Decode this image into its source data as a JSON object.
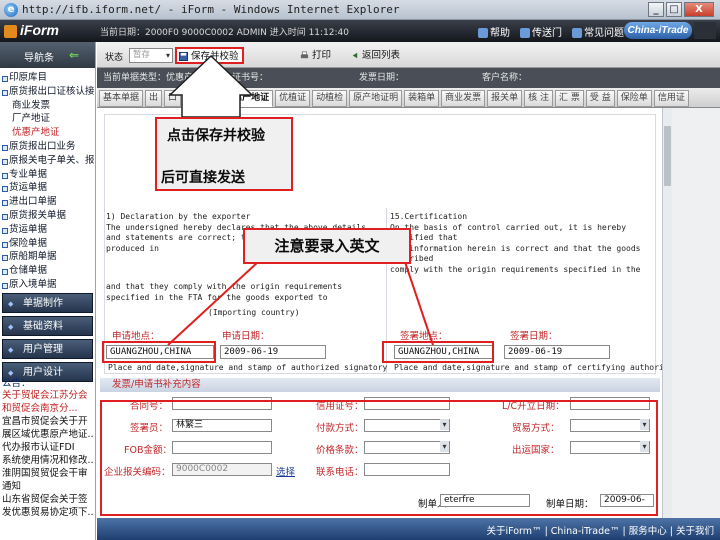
{
  "window": {
    "title": "http://ifb.iform.net/ - iForm - Windows Internet Explorer",
    "buttons": [
      "_",
      "□",
      "X"
    ]
  },
  "app": {
    "logo": "iForm",
    "info": "当前日期：2000F0  9000C0002  ADMIN  进入时间 11:12:40",
    "links": [
      "帮助",
      "传送门",
      "常见问题"
    ],
    "partner_logo": "China-iTrade"
  },
  "sidebar": {
    "header": "导航条",
    "tree": [
      {
        "label": "印原库目",
        "level": 0,
        "active": false
      },
      {
        "label": "原货报出口证核认接",
        "level": 0,
        "active": false
      },
      {
        "label": "商业发票",
        "level": 1,
        "active": false
      },
      {
        "label": "厂产地证",
        "level": 1,
        "active": false
      },
      {
        "label": "优惠产地证",
        "level": 1,
        "active": true
      },
      {
        "label": "原货报出口业务",
        "level": 0,
        "active": false
      },
      {
        "label": "原报关电子单关、报检",
        "level": 0,
        "active": false
      },
      {
        "label": "专业单据",
        "level": 0,
        "active": false
      },
      {
        "label": "货运单据",
        "level": 0,
        "active": false
      },
      {
        "label": "进出口单据",
        "level": 0,
        "active": false
      },
      {
        "label": "原货报关单据",
        "level": 0,
        "active": false
      },
      {
        "label": "货运单据",
        "level": 0,
        "active": false
      },
      {
        "label": "保险单据",
        "level": 0,
        "active": false
      },
      {
        "label": "原船期单据",
        "level": 0,
        "active": false
      },
      {
        "label": "仓储单据",
        "level": 0,
        "active": false
      },
      {
        "label": "原入境单据",
        "level": 0,
        "active": false
      }
    ],
    "menu": [
      "单据制作",
      "基础资料",
      "用户管理",
      "用户设计"
    ],
    "notice_title": "公告：",
    "notices": [
      {
        "text": "关于贸促会江苏分会",
        "hot": true
      },
      {
        "text": "和贸促会南京分...",
        "hot": true
      },
      {
        "text": "宜昌市贸促会关于开",
        "hot": false
      },
      {
        "text": "展区域优惠原产地证...",
        "hot": false
      },
      {
        "text": "代办报市认证FDI",
        "hot": false
      },
      {
        "text": "系统使用情况和修改...",
        "hot": false
      },
      {
        "text": "淮阴国贸贸促会干审",
        "hot": false
      },
      {
        "text": "通知",
        "hot": false
      },
      {
        "text": "山东省贸促会关于签",
        "hot": false
      },
      {
        "text": "发优惠贸易协定项下...",
        "hot": false
      }
    ]
  },
  "toolbar": {
    "status_label": "状态",
    "status_value": "暂存",
    "save_button": "保存并校验",
    "print_button": "打印",
    "return_button": "返回列表"
  },
  "form_header": {
    "doc_type": "当前单据类型：优惠产地证",
    "cert_no": "证书号：",
    "date": "发票日期：",
    "customer": "客户名称："
  },
  "tabs": [
    "基本单据",
    "出",
    "口",
    "单",
    "",
    "优惠产地证",
    "优植证",
    "动植检",
    "原产地证明",
    "装箱单",
    "商业发票",
    "报关单",
    "核 注",
    "汇 票",
    "受 益",
    "保险单",
    "信用证"
  ],
  "content": {
    "cert_left": "1) Declaration by the exporter\nThe undersigned hereby declares that the above details\nand statements are correct; that all the goods were\nproduced in",
    "cert_right": "15.Certification\nOn the basis of control carried out, it is hereby certified that\nthe information herein is correct and that the goods described\ncomply with the origin requirements specified in the Free\nTrade Agreement between the Government of the People's\nRepublic of China and the Government of New Zealand.",
    "cert_comply": "and that they comply with the origin requirements\nspecified in the FTA for the goods exported to",
    "country_hint": "(Importing country)",
    "left_place_label": "申请地点：",
    "left_place_value": "GUANGZHOU,CHINA",
    "left_date_label": "申请日期：",
    "left_date_value": "2009-06-19",
    "left_sign_hint": "Place and date,signature and stamp of authorized signatory",
    "right_place_label": "签署地点：",
    "right_place_value": "GUANGZHOU,CHINA",
    "right_date_label": "签署日期：",
    "right_date_value": "2009-06-19",
    "right_sign_hint": "Place and date,signature and stamp of certifying authority"
  },
  "invoice": {
    "section_title": "发票/申请书补充内容",
    "contract_no": "合同号：",
    "lc_no": "信用证号：",
    "lc_date": "L/C开立日期：",
    "signer": "签署员：",
    "signer_value": "林繁三",
    "pay_method": "付款方式：",
    "trade_method": "贸易方式：",
    "fob_value": "FOB金额：",
    "price_terms": "价格条款：",
    "export_country": "出运国家：",
    "enterprise_no": "企业报关编码：",
    "enterprise_no_value": "9000C0002",
    "select_link": "选择",
    "contact": "联系电话：",
    "maker": "制单人",
    "maker_value": "eterfre",
    "make_date": "制单日期：",
    "make_date_value": "2009-06-19"
  },
  "callouts": {
    "save_tip_1": "点击保存并校验",
    "save_tip_2": "后可直接发送",
    "english_tip": "注意要录入英文"
  },
  "footer": {
    "links": "关于iForm™  |  China-iTrade™  |  服务中心  |  关于我们"
  },
  "colors": {
    "callout_border": "#e02020",
    "arrow_fill": "#ffffff",
    "label_red": "#c0282a",
    "footer_blue": "#1e3e70"
  }
}
